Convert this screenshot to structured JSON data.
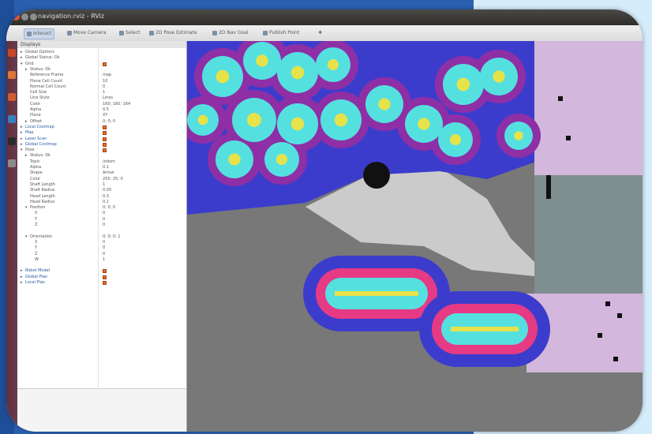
{
  "window": {
    "title": "navigation.rviz - RViz",
    "colors": {
      "close": "#e2552f",
      "minimize": "#8d8d8d",
      "maximize": "#8d8d8d"
    }
  },
  "toolbar": {
    "items": [
      {
        "label": "Interact"
      },
      {
        "label": "Move Camera"
      },
      {
        "label": "Select"
      },
      {
        "label": "2D Pose Estimate"
      },
      {
        "label": "2D Nav Goal"
      },
      {
        "label": "Publish Point"
      }
    ]
  },
  "launcher": {
    "icons": [
      {
        "name": "dash-icon",
        "color": "#c6462b"
      },
      {
        "name": "files-icon",
        "color": "#d8793a"
      },
      {
        "name": "browser-icon",
        "color": "#cf5a30"
      },
      {
        "name": "office-icon",
        "color": "#3a7fc0"
      },
      {
        "name": "terminal-icon",
        "color": "#2c2c2c"
      },
      {
        "name": "settings-icon",
        "color": "#8b8b8b"
      }
    ]
  },
  "panel": {
    "title": "Displays",
    "bottom_text": "",
    "rows": [
      {
        "indent": 0,
        "twisty": "▸",
        "label": "Global Options",
        "value": "",
        "check": false,
        "display": false
      },
      {
        "indent": 0,
        "twisty": "▸",
        "label": "Global Status: Ok",
        "value": "",
        "check": false,
        "display": false
      },
      {
        "indent": 0,
        "twisty": "▾",
        "label": "Grid",
        "value": "",
        "check": true,
        "display": false
      },
      {
        "indent": 1,
        "twisty": "▸",
        "label": "Status: Ok",
        "value": "",
        "check": false,
        "display": false
      },
      {
        "indent": 1,
        "twisty": "",
        "label": "Reference Frame",
        "value": "map",
        "check": false,
        "display": false
      },
      {
        "indent": 1,
        "twisty": "",
        "label": "Plane Cell Count",
        "value": "10",
        "check": false,
        "display": false
      },
      {
        "indent": 1,
        "twisty": "",
        "label": "Normal Cell Count",
        "value": "0",
        "check": false,
        "display": false
      },
      {
        "indent": 1,
        "twisty": "",
        "label": "Cell Size",
        "value": "1",
        "check": false,
        "display": false
      },
      {
        "indent": 1,
        "twisty": "",
        "label": "Line Style",
        "value": "Lines",
        "check": false,
        "display": false
      },
      {
        "indent": 1,
        "twisty": "",
        "label": "Color",
        "value": "160; 160; 164",
        "check": false,
        "display": false
      },
      {
        "indent": 1,
        "twisty": "",
        "label": "Alpha",
        "value": "0.5",
        "check": false,
        "display": false
      },
      {
        "indent": 1,
        "twisty": "",
        "label": "Plane",
        "value": "XY",
        "check": false,
        "display": false
      },
      {
        "indent": 1,
        "twisty": "▸",
        "label": "Offset",
        "value": "0; 0; 0",
        "check": false,
        "display": false
      },
      {
        "indent": 0,
        "twisty": "▸",
        "label": "Local Costmap",
        "value": "",
        "check": true,
        "display": true
      },
      {
        "indent": 0,
        "twisty": "▸",
        "label": "Map",
        "value": "",
        "check": true,
        "display": true
      },
      {
        "indent": 0,
        "twisty": "▸",
        "label": "Laser Scan",
        "value": "",
        "check": true,
        "display": true
      },
      {
        "indent": 0,
        "twisty": "▸",
        "label": "Global Costmap",
        "value": "",
        "check": true,
        "display": true
      },
      {
        "indent": 0,
        "twisty": "▾",
        "label": "Pose",
        "value": "",
        "check": true,
        "display": false
      },
      {
        "indent": 1,
        "twisty": "▸",
        "label": "Status: Ok",
        "value": "",
        "check": false,
        "display": false
      },
      {
        "indent": 1,
        "twisty": "",
        "label": "Topic",
        "value": "/odom",
        "check": false,
        "display": false
      },
      {
        "indent": 1,
        "twisty": "",
        "label": "Alpha",
        "value": "0.1",
        "check": false,
        "display": false
      },
      {
        "indent": 1,
        "twisty": "",
        "label": "Shape",
        "value": "Arrow",
        "check": false,
        "display": false
      },
      {
        "indent": 1,
        "twisty": "",
        "label": "Color",
        "value": "255; 25; 0",
        "check": false,
        "display": false
      },
      {
        "indent": 1,
        "twisty": "",
        "label": "Shaft Length",
        "value": "1",
        "check": false,
        "display": false
      },
      {
        "indent": 1,
        "twisty": "",
        "label": "Shaft Radius",
        "value": "0.05",
        "check": false,
        "display": false
      },
      {
        "indent": 1,
        "twisty": "",
        "label": "Head Length",
        "value": "0.3",
        "check": false,
        "display": false
      },
      {
        "indent": 1,
        "twisty": "",
        "label": "Head Radius",
        "value": "0.1",
        "check": false,
        "display": false
      },
      {
        "indent": 1,
        "twisty": "▾",
        "label": "Position",
        "value": "0; 0; 0",
        "check": false,
        "display": false
      },
      {
        "indent": 2,
        "twisty": "",
        "label": "X",
        "value": "0",
        "check": false,
        "display": false
      },
      {
        "indent": 2,
        "twisty": "",
        "label": "Y",
        "value": "0",
        "check": false,
        "display": false
      },
      {
        "indent": 2,
        "twisty": "",
        "label": "Z",
        "value": "0",
        "check": false,
        "display": false
      },
      {
        "indent": 2,
        "twisty": "",
        "label": "",
        "value": "",
        "check": false,
        "display": false
      },
      {
        "indent": 1,
        "twisty": "▾",
        "label": "Orientation",
        "value": "0; 0; 0; 1",
        "check": false,
        "display": false
      },
      {
        "indent": 2,
        "twisty": "",
        "label": "X",
        "value": "0",
        "check": false,
        "display": false
      },
      {
        "indent": 2,
        "twisty": "",
        "label": "Y",
        "value": "0",
        "check": false,
        "display": false
      },
      {
        "indent": 2,
        "twisty": "",
        "label": "Z",
        "value": "0",
        "check": false,
        "display": false
      },
      {
        "indent": 2,
        "twisty": "",
        "label": "W",
        "value": "1",
        "check": false,
        "display": false
      },
      {
        "indent": 2,
        "twisty": "",
        "label": "",
        "value": "",
        "check": false,
        "display": false
      },
      {
        "indent": 0,
        "twisty": "▸",
        "label": "Robot Model",
        "value": "",
        "check": true,
        "display": true
      },
      {
        "indent": 0,
        "twisty": "▸",
        "label": "Global Plan",
        "value": "",
        "check": true,
        "display": true
      },
      {
        "indent": 0,
        "twisty": "▸",
        "label": "Local Plan",
        "value": "",
        "check": true,
        "display": true
      }
    ]
  },
  "costmap": {
    "colors": {
      "background": "#787878",
      "free": "#cbcbcb",
      "inflation_outer": "#3c3ccc",
      "inflation_mid": "#8e2fa6",
      "inflation_inner": "#e63a84",
      "lethal_near": "#55e0e0",
      "lethal": "#e6e24a",
      "unknown_light": "#d3b7dc",
      "robot": "#111111"
    }
  }
}
